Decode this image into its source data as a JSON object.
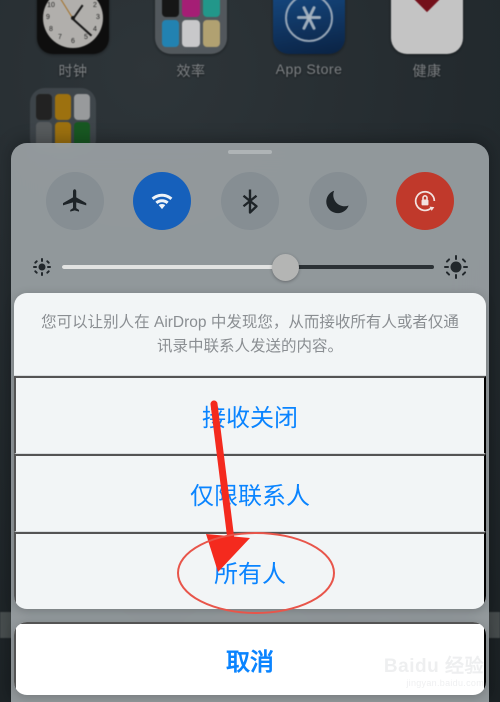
{
  "homescreen": {
    "apps": [
      {
        "label": "时钟",
        "icon": "clock-icon"
      },
      {
        "label": "效率",
        "icon": "folder-icon"
      },
      {
        "label": "App Store",
        "icon": "app-store-icon"
      },
      {
        "label": "健康",
        "icon": "health-icon"
      }
    ],
    "folder_row2": {
      "icon": "folder-icon"
    },
    "folder_colors": [
      "#1b1b1b",
      "#c9258f",
      "#29b8a8",
      "#2a9fd8",
      "#f4f4f6",
      "#d8c48a"
    ],
    "folder2_colors": [
      "#2a2a2a",
      "#c08a12",
      "#b9bcbe",
      "#6a6f72",
      "#c08a12",
      "#1d6b2a"
    ],
    "dock_colors": [
      "#4d6b55",
      "#143d22",
      "#8d8f90",
      "#2b2b2b",
      "#1a1f26"
    ]
  },
  "control_center": {
    "toggles": [
      {
        "name": "airplane-mode",
        "icon": "airplane-icon",
        "active": false
      },
      {
        "name": "wifi",
        "icon": "wifi-icon",
        "active": true
      },
      {
        "name": "bluetooth",
        "icon": "bluetooth-icon",
        "active": false
      },
      {
        "name": "do-not-disturb",
        "icon": "moon-icon",
        "active": false
      },
      {
        "name": "rotation-lock",
        "icon": "rotation-lock-icon",
        "active": true
      }
    ],
    "brightness": {
      "label_low": "brightness-low-icon",
      "label_high": "brightness-high-icon",
      "value": 60
    },
    "colors": {
      "wifi_on": "#1660bb",
      "rotation_lock_on": "#c0392b",
      "toggle_off": "#868d92",
      "panel": "#9aa0a4"
    }
  },
  "action_sheet": {
    "header": "您可以让别人在 AirDrop 中发现您，从而接收所有人或者仅通讯录中联系人发送的内容。",
    "options": [
      {
        "label": "接收关闭",
        "name": "receiving-off-option"
      },
      {
        "label": "仅限联系人",
        "name": "contacts-only-option"
      },
      {
        "label": "所有人",
        "name": "everyone-option",
        "highlighted": true
      }
    ],
    "cancel": "取消",
    "accent_color": "#0a84ff"
  },
  "annotations": {
    "arrow_color": "#f42a1e",
    "ellipse_color": "#e8554a",
    "target": "所有人"
  },
  "watermark": {
    "main": "Bai",
    "main2": "du",
    "suffix": "经验",
    "sub": "jingyan.baidu.com"
  }
}
